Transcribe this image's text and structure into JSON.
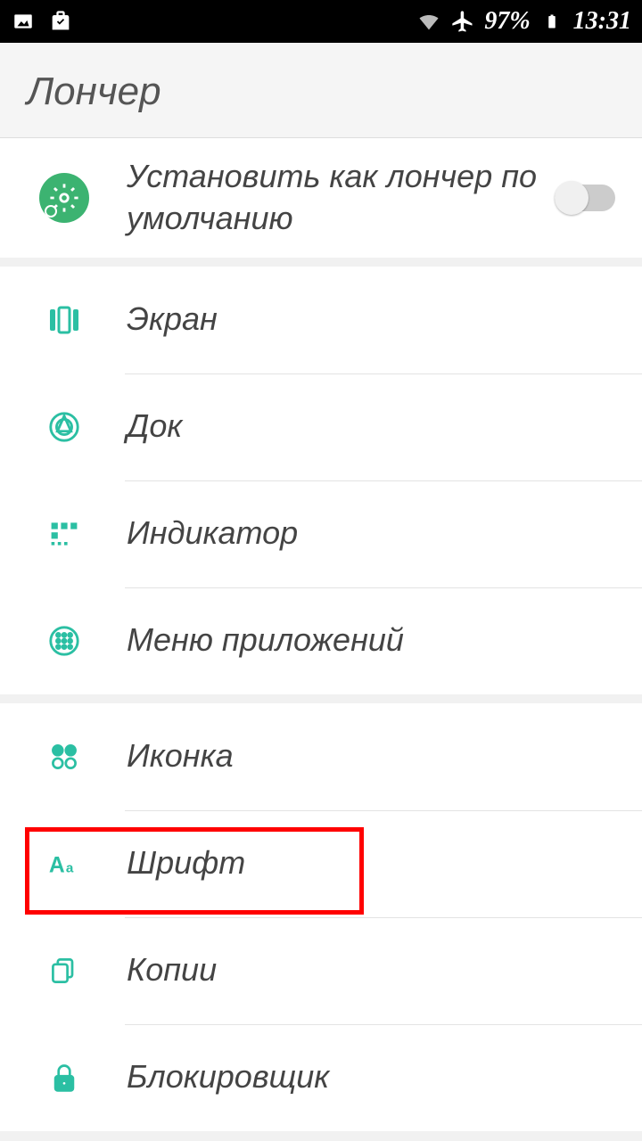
{
  "status": {
    "battery": "97%",
    "time": "13:31"
  },
  "header": {
    "title": "Лончер"
  },
  "section1": {
    "default_launcher": "Установить как лончер по умолчанию"
  },
  "section2": {
    "screen": "Экран",
    "dock": "Док",
    "indicator": "Индикатор",
    "apps_menu": "Меню приложений"
  },
  "section3": {
    "icon": "Иконка",
    "font": "Шрифт",
    "copies": "Копии",
    "blocker": "Блокировщик"
  }
}
